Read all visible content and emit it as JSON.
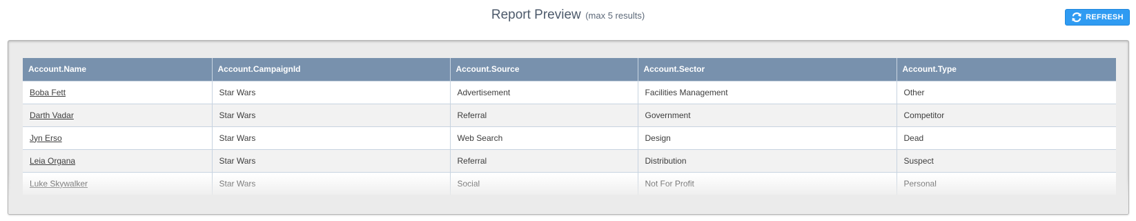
{
  "header": {
    "title": "Report Preview",
    "subtitle": "(max 5 results)",
    "refresh_label": "REFRESH",
    "refresh_icon": "refresh-icon",
    "accent_color": "#2f9bf2"
  },
  "table": {
    "header_color": "#7891ad",
    "columns": [
      "Account.Name",
      "Account.CampaignId",
      "Account.Source",
      "Account.Sector",
      "Account.Type"
    ],
    "rows": [
      [
        "Boba Fett",
        "Star Wars",
        "Advertisement",
        "Facilities Management",
        "Other"
      ],
      [
        "Darth Vadar",
        "Star Wars",
        "Referral",
        "Government",
        "Competitor"
      ],
      [
        "Jyn Erso",
        "Star Wars",
        "Web Search",
        "Design",
        "Dead"
      ],
      [
        "Leia Organa",
        "Star Wars",
        "Referral",
        "Distribution",
        "Suspect"
      ],
      [
        "Luke Skywalker",
        "Star Wars",
        "Social",
        "Not For Profit",
        "Personal"
      ]
    ]
  }
}
